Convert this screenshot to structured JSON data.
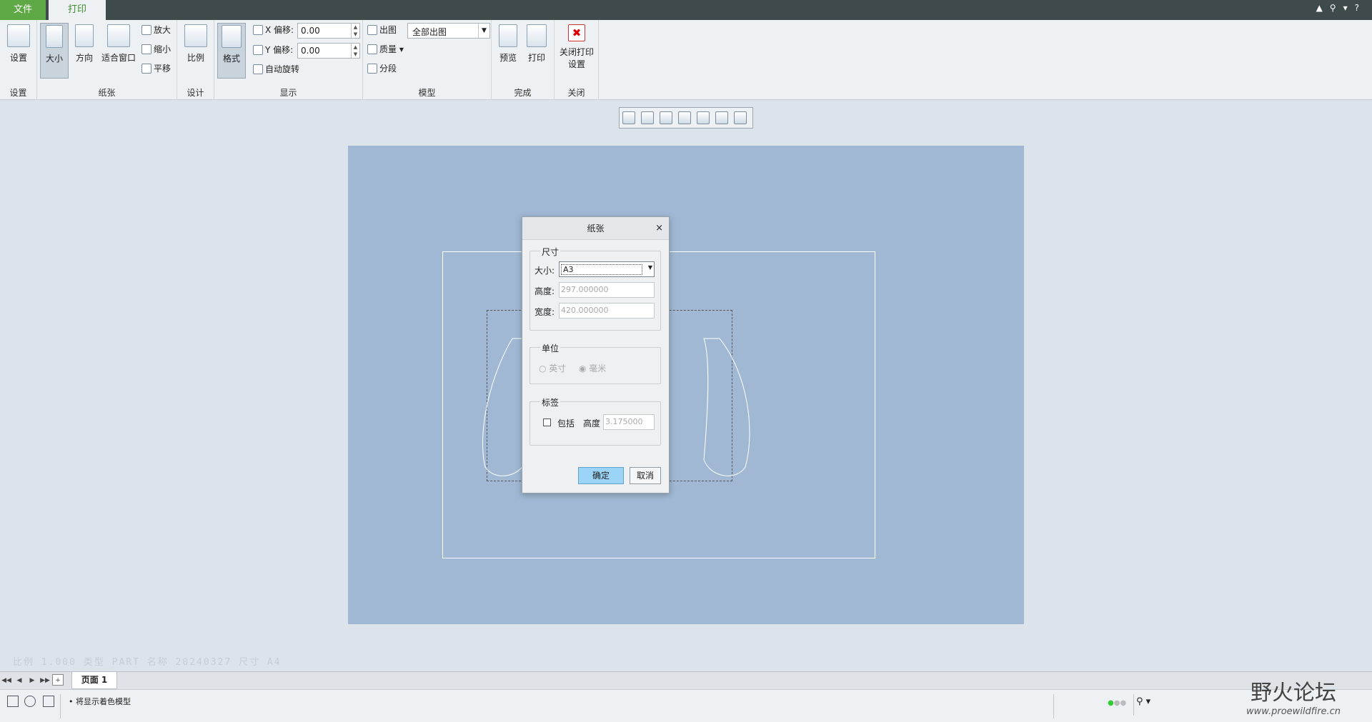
{
  "tabs": {
    "file": "文件",
    "print": "打印"
  },
  "ribbon": {
    "settings": {
      "button": "设置",
      "group": "设置"
    },
    "paper": {
      "size": "大小",
      "orientation": "方向",
      "fit": "适合窗口",
      "zoom_in": "放大",
      "zoom_out": "缩小",
      "pan": "平移",
      "group": "纸张"
    },
    "design": {
      "scale": "比例",
      "group": "设计"
    },
    "display": {
      "format": "格式",
      "x_offset_label": "X 偏移:",
      "x_offset_value": "0.00",
      "y_offset_label": "Y 偏移:",
      "y_offset_value": "0.00",
      "auto_rotate": "自动旋转",
      "group": "显示"
    },
    "model": {
      "plot": "出图",
      "plot_select": "全部出图",
      "quality": "质量",
      "segment": "分段",
      "group": "模型"
    },
    "finish": {
      "preview": "预览",
      "print": "打印",
      "group": "完成"
    },
    "close": {
      "button_line1": "关闭打印",
      "button_line2": "设置",
      "group": "关闭"
    }
  },
  "canvas_footer": "比例 1.000 类型 PART 名称 20240327 尺寸 A4",
  "dialog": {
    "title": "纸张",
    "size_legend": "尺寸",
    "size_label": "大小:",
    "size_value": "A3",
    "height_label": "高度:",
    "height_value": "297.000000",
    "width_label": "宽度:",
    "width_value": "420.000000",
    "unit_legend": "单位",
    "unit_inch": "英寸",
    "unit_mm": "毫米",
    "label_legend": "标签",
    "include": "包括",
    "label_height_label": "高度",
    "label_height_value": "3.175000",
    "ok": "确定",
    "cancel": "取消"
  },
  "page_tab": "页面 1",
  "status_message": "将显示着色模型",
  "logo": {
    "line1": "野火论坛",
    "line2": "www.proewildfire.cn"
  }
}
